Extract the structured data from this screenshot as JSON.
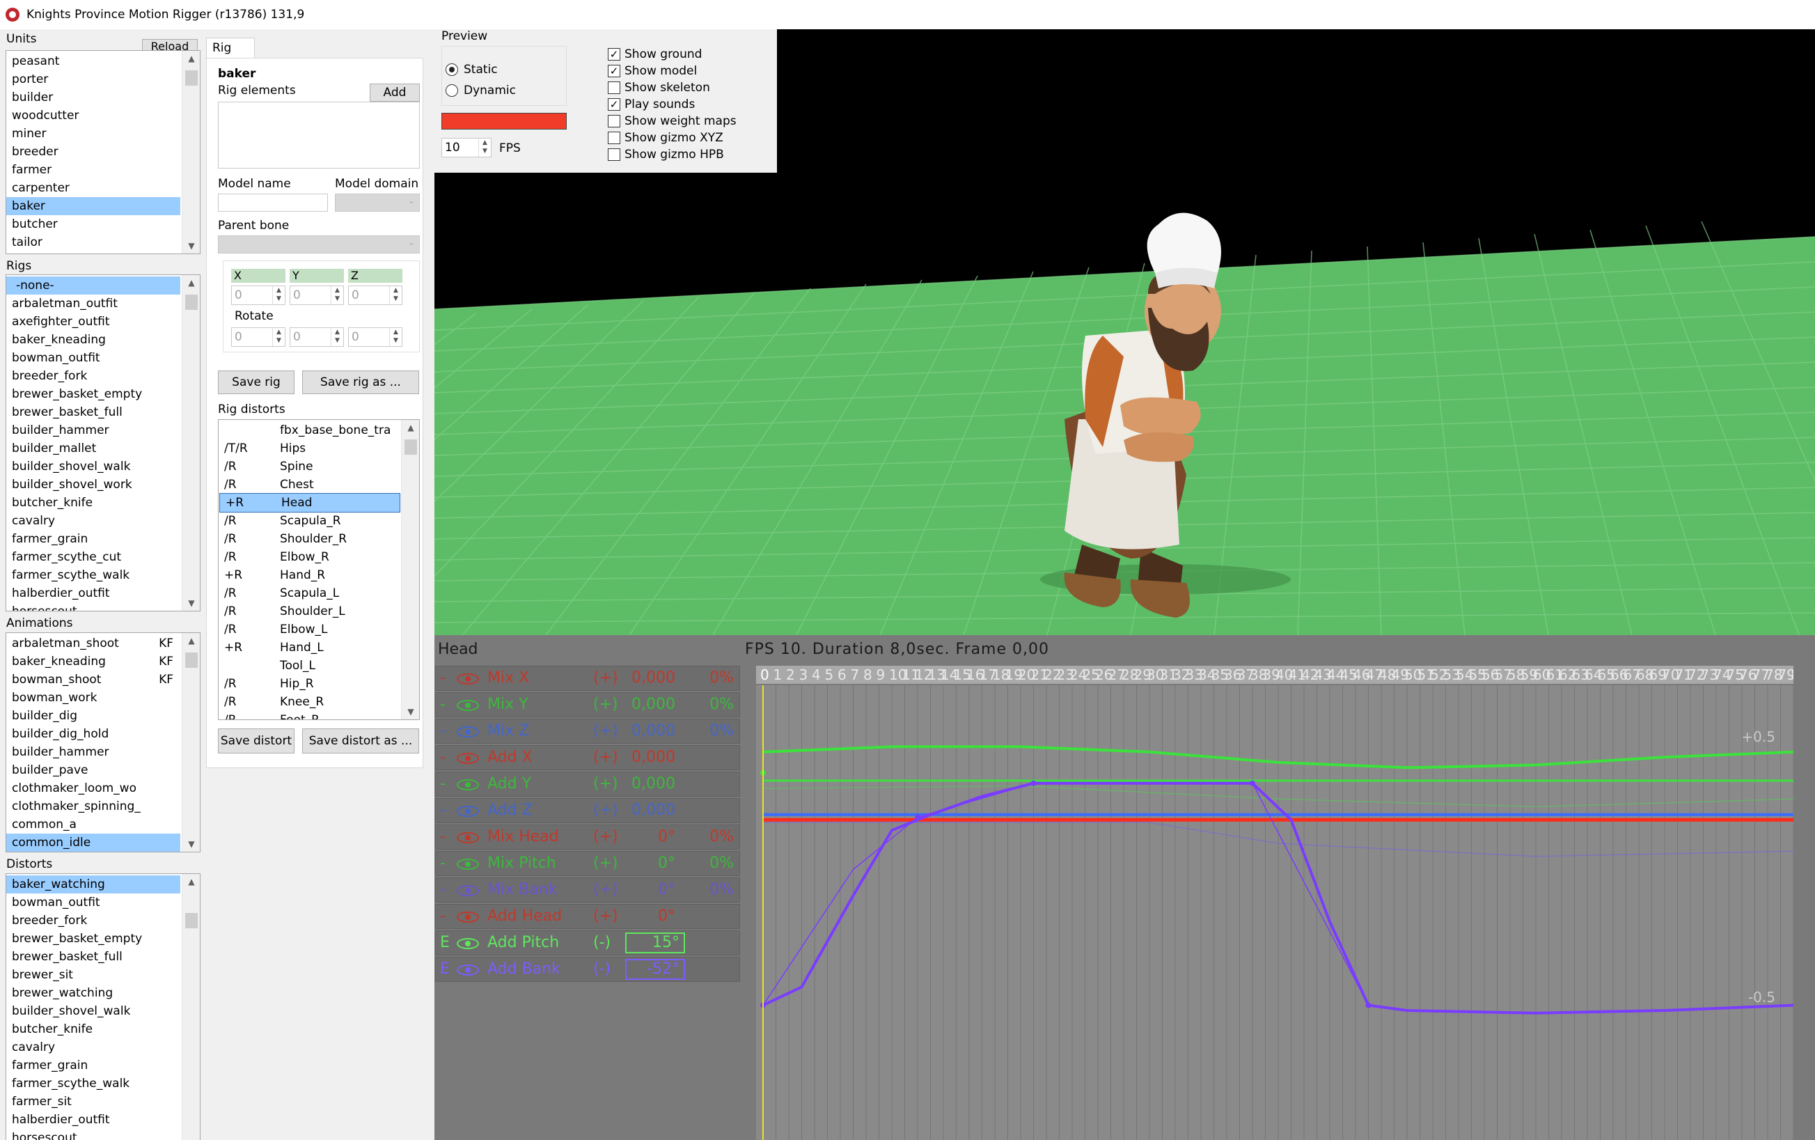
{
  "window": {
    "title": "Knights Province Motion Rigger (r13786) 131,9"
  },
  "units": {
    "label": "Units",
    "reload_label": "Reload",
    "items": [
      "peasant",
      "porter",
      "builder",
      "woodcutter",
      "miner",
      "breeder",
      "farmer",
      "carpenter",
      "baker",
      "butcher",
      "tailor"
    ],
    "selected": "baker"
  },
  "rigs": {
    "label": "Rigs",
    "items": [
      "-none-",
      "arbaletman_outfit",
      "axefighter_outfit",
      "baker_kneading",
      "bowman_outfit",
      "breeder_fork",
      "brewer_basket_empty",
      "brewer_basket_full",
      "builder_hammer",
      "builder_mallet",
      "builder_shovel_walk",
      "builder_shovel_work",
      "butcher_knife",
      "cavalry",
      "farmer_grain",
      "farmer_scythe_cut",
      "farmer_scythe_walk",
      "halberdier_outfit",
      "horsescout"
    ],
    "selected": "-none-"
  },
  "animations": {
    "label": "Animations",
    "items": [
      {
        "name": "arbaletman_shoot",
        "tag": "KF"
      },
      {
        "name": "baker_kneading",
        "tag": "KF"
      },
      {
        "name": "bowman_shoot",
        "tag": "KF"
      },
      {
        "name": "bowman_work",
        "tag": ""
      },
      {
        "name": "builder_dig",
        "tag": ""
      },
      {
        "name": "builder_dig_hold",
        "tag": ""
      },
      {
        "name": "builder_hammer",
        "tag": ""
      },
      {
        "name": "builder_pave",
        "tag": ""
      },
      {
        "name": "clothmaker_loom_wo",
        "tag": ""
      },
      {
        "name": "clothmaker_spinning_",
        "tag": ""
      },
      {
        "name": "common_a",
        "tag": ""
      },
      {
        "name": "common_idle",
        "tag": ""
      }
    ],
    "selected": "common_idle"
  },
  "distorts": {
    "label": "Distorts",
    "items": [
      "baker_watching",
      "bowman_outfit",
      "breeder_fork",
      "brewer_basket_empty",
      "brewer_basket_full",
      "brewer_sit",
      "brewer_watching",
      "builder_shovel_walk",
      "butcher_knife",
      "cavalry",
      "farmer_grain",
      "farmer_scythe_walk",
      "farmer_sit",
      "halberdier_outfit",
      "horsescout"
    ],
    "selected": "baker_watching"
  },
  "rig_panel": {
    "tab_label": "Rig",
    "unit_name": "baker",
    "rig_elements_label": "Rig elements",
    "add_label": "Add",
    "model_name_label": "Model name",
    "model_domain_label": "Model domain",
    "parent_bone_label": "Parent bone",
    "x_label": "X",
    "y_label": "Y",
    "z_label": "Z",
    "offset": {
      "x": "0",
      "y": "0",
      "z": "0"
    },
    "rotate_label": "Rotate",
    "rotate": {
      "x": "0",
      "y": "0",
      "z": "0"
    },
    "save_rig_label": "Save rig",
    "save_rig_as_label": "Save rig as ...",
    "rig_distorts_label": "Rig distorts",
    "distort_rows": [
      {
        "flag": "",
        "bone": "fbx_base_bone_tra"
      },
      {
        "flag": "/T/R",
        "bone": "Hips"
      },
      {
        "flag": "/R",
        "bone": "Spine"
      },
      {
        "flag": "/R",
        "bone": "Chest"
      },
      {
        "flag": "+R",
        "bone": "Head"
      },
      {
        "flag": "/R",
        "bone": "Scapula_R"
      },
      {
        "flag": "/R",
        "bone": "Shoulder_R"
      },
      {
        "flag": "/R",
        "bone": "Elbow_R"
      },
      {
        "flag": "+R",
        "bone": "Hand_R"
      },
      {
        "flag": "/R",
        "bone": "Scapula_L"
      },
      {
        "flag": "/R",
        "bone": "Shoulder_L"
      },
      {
        "flag": "/R",
        "bone": "Elbow_L"
      },
      {
        "flag": "+R",
        "bone": "Hand_L"
      },
      {
        "flag": "",
        "bone": "Tool_L"
      },
      {
        "flag": "/R",
        "bone": "Hip_R"
      },
      {
        "flag": "/R",
        "bone": "Knee_R"
      },
      {
        "flag": "/R",
        "bone": "Foot_R"
      }
    ],
    "selected_distort": "Head",
    "save_distort_label": "Save distort",
    "save_distort_as_label": "Save distort as ..."
  },
  "preview": {
    "label": "Preview",
    "static_label": "Static",
    "dynamic_label": "Dynamic",
    "mode": "static",
    "color": "#f03c28",
    "fps_value": "10",
    "fps_label": "FPS",
    "options": [
      {
        "label": "Show ground",
        "checked": true
      },
      {
        "label": "Show model",
        "checked": true
      },
      {
        "label": "Show skeleton",
        "checked": false
      },
      {
        "label": "Play sounds",
        "checked": true
      },
      {
        "label": "Show weight maps",
        "checked": false
      },
      {
        "label": "Show gizmo XYZ",
        "checked": false
      },
      {
        "label": "Show gizmo HPB",
        "checked": false
      }
    ]
  },
  "timeline": {
    "bone_label": "Head",
    "status": "FPS 10. Duration 8,0sec. Frame 0,00",
    "frame_count": 80,
    "upper_tick": "+0.5",
    "lower_tick": "-0.5",
    "controls": [
      {
        "prefix": "-",
        "label": "Mix X",
        "op": "(+)",
        "value": "0,000",
        "pct": "0%",
        "color": "#c0392b"
      },
      {
        "prefix": "-",
        "label": "Mix Y",
        "op": "(+)",
        "value": "0,000",
        "pct": "0%",
        "color": "#3cb83c"
      },
      {
        "prefix": "-",
        "label": "Mix Z",
        "op": "(+)",
        "value": "0,000",
        "pct": "0%",
        "color": "#4466cc"
      },
      {
        "prefix": "-",
        "label": "Add X",
        "op": "(+)",
        "value": "0,000",
        "pct": "",
        "color": "#c0392b"
      },
      {
        "prefix": "-",
        "label": "Add Y",
        "op": "(+)",
        "value": "0,000",
        "pct": "",
        "color": "#3cb83c"
      },
      {
        "prefix": "-",
        "label": "Add Z",
        "op": "(+)",
        "value": "0,000",
        "pct": "",
        "color": "#4466cc"
      },
      {
        "prefix": "-",
        "label": "Mix Head",
        "op": "(+)",
        "value": "0°",
        "pct": "0%",
        "color": "#c0392b"
      },
      {
        "prefix": "-",
        "label": "Mix Pitch",
        "op": "(+)",
        "value": "0°",
        "pct": "0%",
        "color": "#3cb83c"
      },
      {
        "prefix": "-",
        "label": "Mix Bank",
        "op": "(+)",
        "value": "0°",
        "pct": "0%",
        "color": "#6a55cc"
      },
      {
        "prefix": "-",
        "label": "Add Head",
        "op": "(+)",
        "value": "0°",
        "pct": "",
        "color": "#c0392b"
      },
      {
        "prefix": "E",
        "label": "Add Pitch",
        "op": "(-)",
        "value": "15°",
        "pct": "",
        "color": "#5ee65e",
        "boxed": true
      },
      {
        "prefix": "E",
        "label": "Add Bank",
        "op": "(-)",
        "value": "-52°",
        "pct": "",
        "color": "#7d5cff",
        "boxed": true
      }
    ],
    "curve_colors": {
      "green": "#3ce23c",
      "red": "#ff2a1a",
      "blue": "#3a6cff",
      "purple": "#7a3cff",
      "playhead": "#e6e61e"
    }
  }
}
